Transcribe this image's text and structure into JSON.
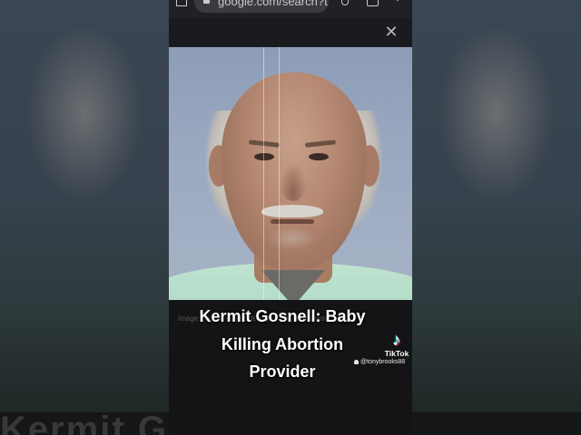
{
  "browser": {
    "url": "google.com/search?t"
  },
  "image_viewer": {
    "source_note": "Image may be subject to copyright. Learn More"
  },
  "video": {
    "caption": "Kermit Gosnell: Baby Killing Abortion Provider",
    "caption_lines": [
      "Kermit Gosnell: Baby",
      "Killing Abortion",
      "Provider"
    ],
    "watermark_brand": "TikTok",
    "watermark_handle": "@tonybrooks88",
    "background_caption": "Kermit Gosnell"
  },
  "icons": {
    "home": "home-icon",
    "lock": "lock-icon",
    "mic": "mic-icon",
    "tabs": "tabs-icon",
    "menu": "menu-icon",
    "close": "close-icon",
    "tiktok": "tiktok-logo-icon",
    "user": "user-icon"
  },
  "colors": {
    "screen_background": "#101013",
    "photo_background": "#9aa8c0",
    "shirt": "#bfe3d0",
    "caption_text": "#ffffff"
  }
}
